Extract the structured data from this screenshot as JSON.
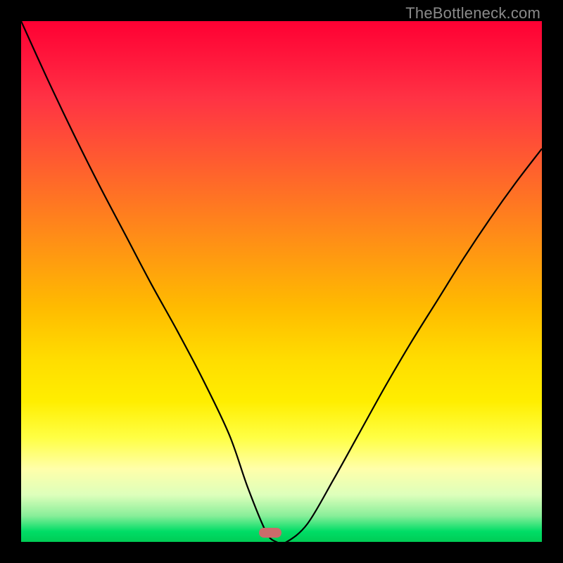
{
  "watermark": "TheBottleneck.com",
  "marker": {
    "x_frac": 0.478,
    "y_frac": 0.983
  },
  "chart_data": {
    "type": "line",
    "title": "",
    "xlabel": "",
    "ylabel": "",
    "x": [
      0.0,
      0.05,
      0.1,
      0.15,
      0.2,
      0.25,
      0.3,
      0.35,
      0.4,
      0.435,
      0.47,
      0.49,
      0.51,
      0.55,
      0.6,
      0.65,
      0.7,
      0.75,
      0.8,
      0.85,
      0.9,
      0.95,
      1.0
    ],
    "values": [
      1.0,
      0.89,
      0.785,
      0.685,
      0.59,
      0.495,
      0.405,
      0.31,
      0.205,
      0.105,
      0.02,
      0.0,
      0.0,
      0.035,
      0.12,
      0.21,
      0.3,
      0.385,
      0.465,
      0.545,
      0.62,
      0.69,
      0.755
    ],
    "xlim": [
      0,
      1
    ],
    "ylim": [
      0,
      1
    ],
    "background_gradient": {
      "top": "#ff0033",
      "bottom": "#00cc55"
    },
    "minimum_marker": {
      "x": 0.49,
      "y": 0.0,
      "color": "#cc6b6b"
    }
  }
}
